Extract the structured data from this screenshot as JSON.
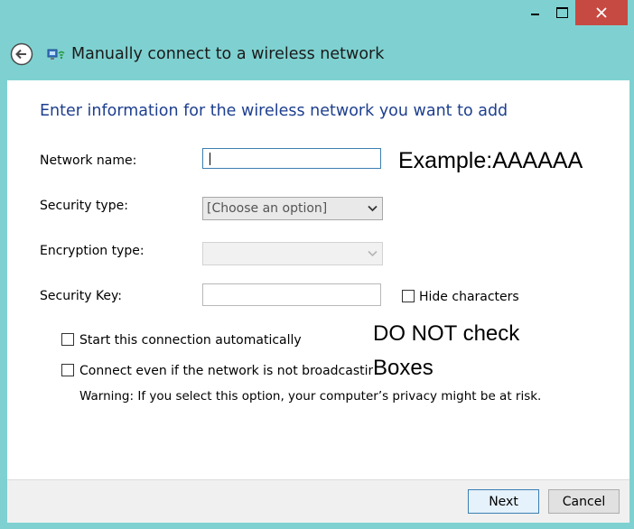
{
  "window": {
    "title": "Manually connect to a wireless network"
  },
  "heading": "Enter information for the wireless network you want to add",
  "form": {
    "network_name": {
      "label": "Network name:",
      "value": ""
    },
    "security_type": {
      "label": "Security type:",
      "selected": "[Choose an option]"
    },
    "encryption_type": {
      "label": "Encryption type:",
      "selected": ""
    },
    "security_key": {
      "label": "Security Key:",
      "value": ""
    },
    "hide_characters": {
      "label": "Hide characters",
      "checked": false
    },
    "start_automatically": {
      "label": "Start this connection automatically",
      "checked": false
    },
    "connect_not_broadcasting": {
      "label": "Connect even if the network is not broadcasting",
      "checked": false
    },
    "warning": "Warning: If you select this option, your computer’s privacy might be at risk."
  },
  "annotations": {
    "example": "Example:AAAAAA",
    "do_not_check_line1": "DO NOT check",
    "do_not_check_line2": "Boxes"
  },
  "buttons": {
    "next": "Next",
    "cancel": "Cancel"
  },
  "colors": {
    "background": "#7fd1d1",
    "heading": "#1e3f8f",
    "close_button": "#c74a42",
    "focus_border": "#3c7fb1"
  },
  "icons": [
    "minimize-icon",
    "maximize-icon",
    "close-icon",
    "back-arrow-icon",
    "wireless-network-icon",
    "chevron-down-icon"
  ]
}
